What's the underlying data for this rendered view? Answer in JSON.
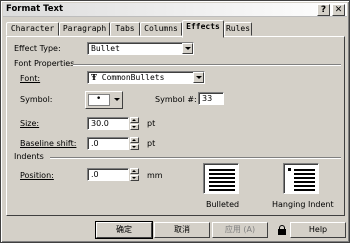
{
  "window": {
    "title": "Format Text",
    "help_glyph": "?",
    "close_glyph": "✕"
  },
  "tabs": [
    {
      "label": "Character"
    },
    {
      "label": "Paragraph"
    },
    {
      "label": "Tabs"
    },
    {
      "label": "Columns"
    },
    {
      "label": "Effects",
      "active": true
    },
    {
      "label": "Rules"
    }
  ],
  "effects": {
    "effect_type_label": "Effect Type:",
    "effect_type_value": "Bullet",
    "font_properties_label": "Font Properties",
    "font_label": "Font:",
    "font_value": "CommonBullets",
    "font_glyph": "Ŧ",
    "symbol_label": "Symbol:",
    "symbol_glyph": "•",
    "symbol_num_label": "Symbol #:",
    "symbol_num_value": "33",
    "size_label": "Size:",
    "size_value": "30.0",
    "size_unit": "pt",
    "baseline_label": "Baseline shift:",
    "baseline_value": ".0",
    "baseline_unit": "pt",
    "indents_label": "Indents",
    "position_label": "Position:",
    "position_value": ".0",
    "position_unit": "mm",
    "bulleted_label": "Bulleted",
    "hanging_label": "Hanging Indent"
  },
  "buttons": {
    "ok": "确定",
    "cancel": "取消",
    "apply": "应用 (A)",
    "help": "Help"
  }
}
